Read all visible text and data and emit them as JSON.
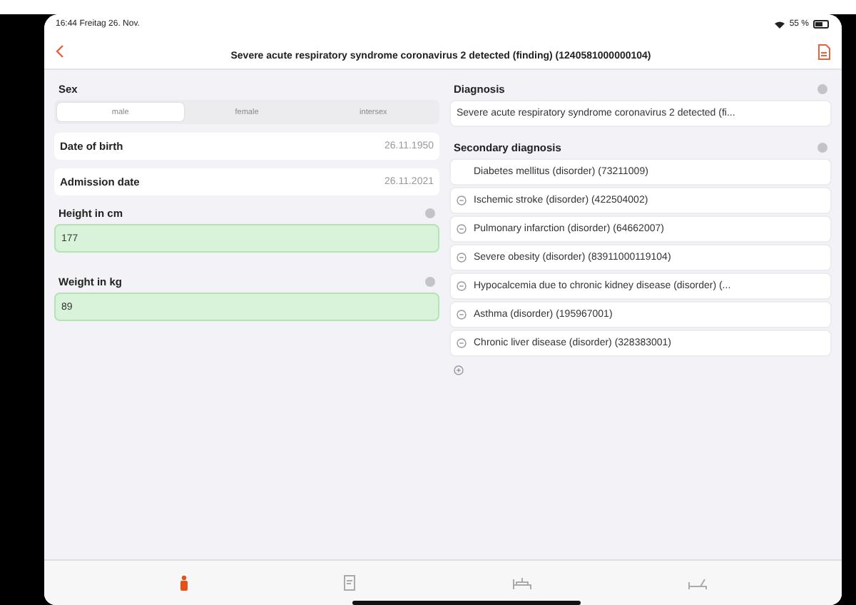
{
  "status_bar": {
    "time": "16:44",
    "date": "Freitag 26. Nov.",
    "battery": "55 %"
  },
  "nav": {
    "title": "Severe acute respiratory syndrome coronavirus 2 detected (finding) (1240581000000104)"
  },
  "sex": {
    "label": "Sex",
    "options": [
      {
        "label": "male",
        "selected": true
      },
      {
        "label": "female",
        "selected": false
      },
      {
        "label": "intersex",
        "selected": false
      }
    ]
  },
  "dates": [
    {
      "label": "Date of birth",
      "value": "26.11.1950"
    },
    {
      "label": "Admission date",
      "value": "26.11.2021"
    }
  ],
  "measures": [
    {
      "label": "Height in cm",
      "value": "177"
    },
    {
      "label": "Weight in kg",
      "value": "89"
    }
  ],
  "diagnosis": {
    "label": "Diagnosis",
    "value": "Severe acute respiratory syndrome coronavirus 2 detected (fi..."
  },
  "secondary": {
    "label": "Secondary diagnosis",
    "items": [
      {
        "text": "Diabetes mellitus (disorder) (73211009)",
        "removable": false
      },
      {
        "text": "Ischemic stroke (disorder) (422504002)",
        "removable": true
      },
      {
        "text": "Pulmonary infarction (disorder) (64662007)",
        "removable": true
      },
      {
        "text": "Severe obesity (disorder) (83911000119104)",
        "removable": true
      },
      {
        "text": "Hypocalcemia due to chronic kidney disease (disorder) (...",
        "removable": true
      },
      {
        "text": "Asthma (disorder) (195967001)",
        "removable": true
      },
      {
        "text": "Chronic liver disease (disorder) (328383001)",
        "removable": true
      }
    ]
  },
  "tab_bar": [
    {
      "kind": "person",
      "selected": true
    },
    {
      "kind": "form",
      "selected": false
    },
    {
      "kind": "bed",
      "selected": false
    },
    {
      "kind": "recline",
      "selected": false
    }
  ]
}
